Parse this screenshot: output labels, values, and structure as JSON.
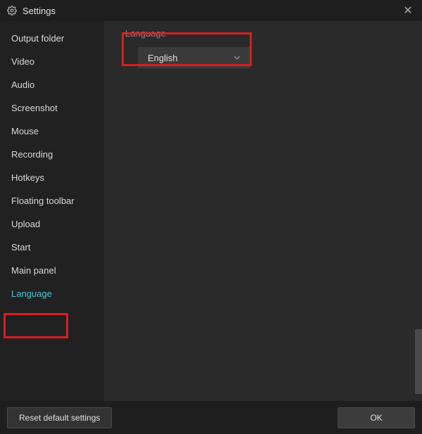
{
  "titlebar": {
    "title": "Settings"
  },
  "sidebar": {
    "items": [
      {
        "label": "Output folder"
      },
      {
        "label": "Video"
      },
      {
        "label": "Audio"
      },
      {
        "label": "Screenshot"
      },
      {
        "label": "Mouse"
      },
      {
        "label": "Recording"
      },
      {
        "label": "Hotkeys"
      },
      {
        "label": "Floating toolbar"
      },
      {
        "label": "Upload"
      },
      {
        "label": "Start"
      },
      {
        "label": "Main panel"
      },
      {
        "label": "Language"
      }
    ]
  },
  "main": {
    "section_label": "Language",
    "language_dropdown": {
      "value": "English"
    }
  },
  "footer": {
    "reset_label": "Reset default settings",
    "ok_label": "OK"
  }
}
